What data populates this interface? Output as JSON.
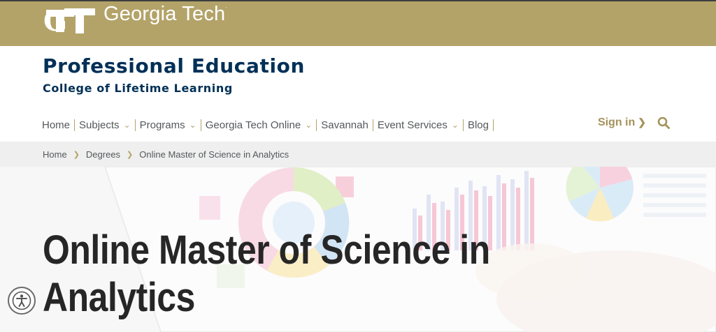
{
  "header": {
    "logo_name": "gt-monogram-icon",
    "wordmark": "Georgia Tech",
    "brand_color": "#b3a369"
  },
  "brand": {
    "title": "Professional Education",
    "subtitle": "College of Lifetime Learning",
    "color": "#003057"
  },
  "nav": {
    "items": [
      {
        "label": "Home",
        "has_dropdown": false
      },
      {
        "label": "Subjects",
        "has_dropdown": true
      },
      {
        "label": "Programs",
        "has_dropdown": true
      },
      {
        "label": "Georgia Tech Online",
        "has_dropdown": true
      },
      {
        "label": "Savannah",
        "has_dropdown": false
      },
      {
        "label": "Event Services",
        "has_dropdown": true
      },
      {
        "label": "Blog",
        "has_dropdown": false
      }
    ],
    "signin_label": "Sign in",
    "signin_arrow": "❯",
    "dropdown_glyph": "⌄",
    "search_icon": "search-icon"
  },
  "breadcrumb": {
    "items": [
      "Home",
      "Degrees",
      "Online Master of Science in Analytics"
    ],
    "separator": "❯"
  },
  "hero": {
    "title": "Online Master of Science in Analytics"
  },
  "accessibility": {
    "icon": "accessibility-icon"
  }
}
